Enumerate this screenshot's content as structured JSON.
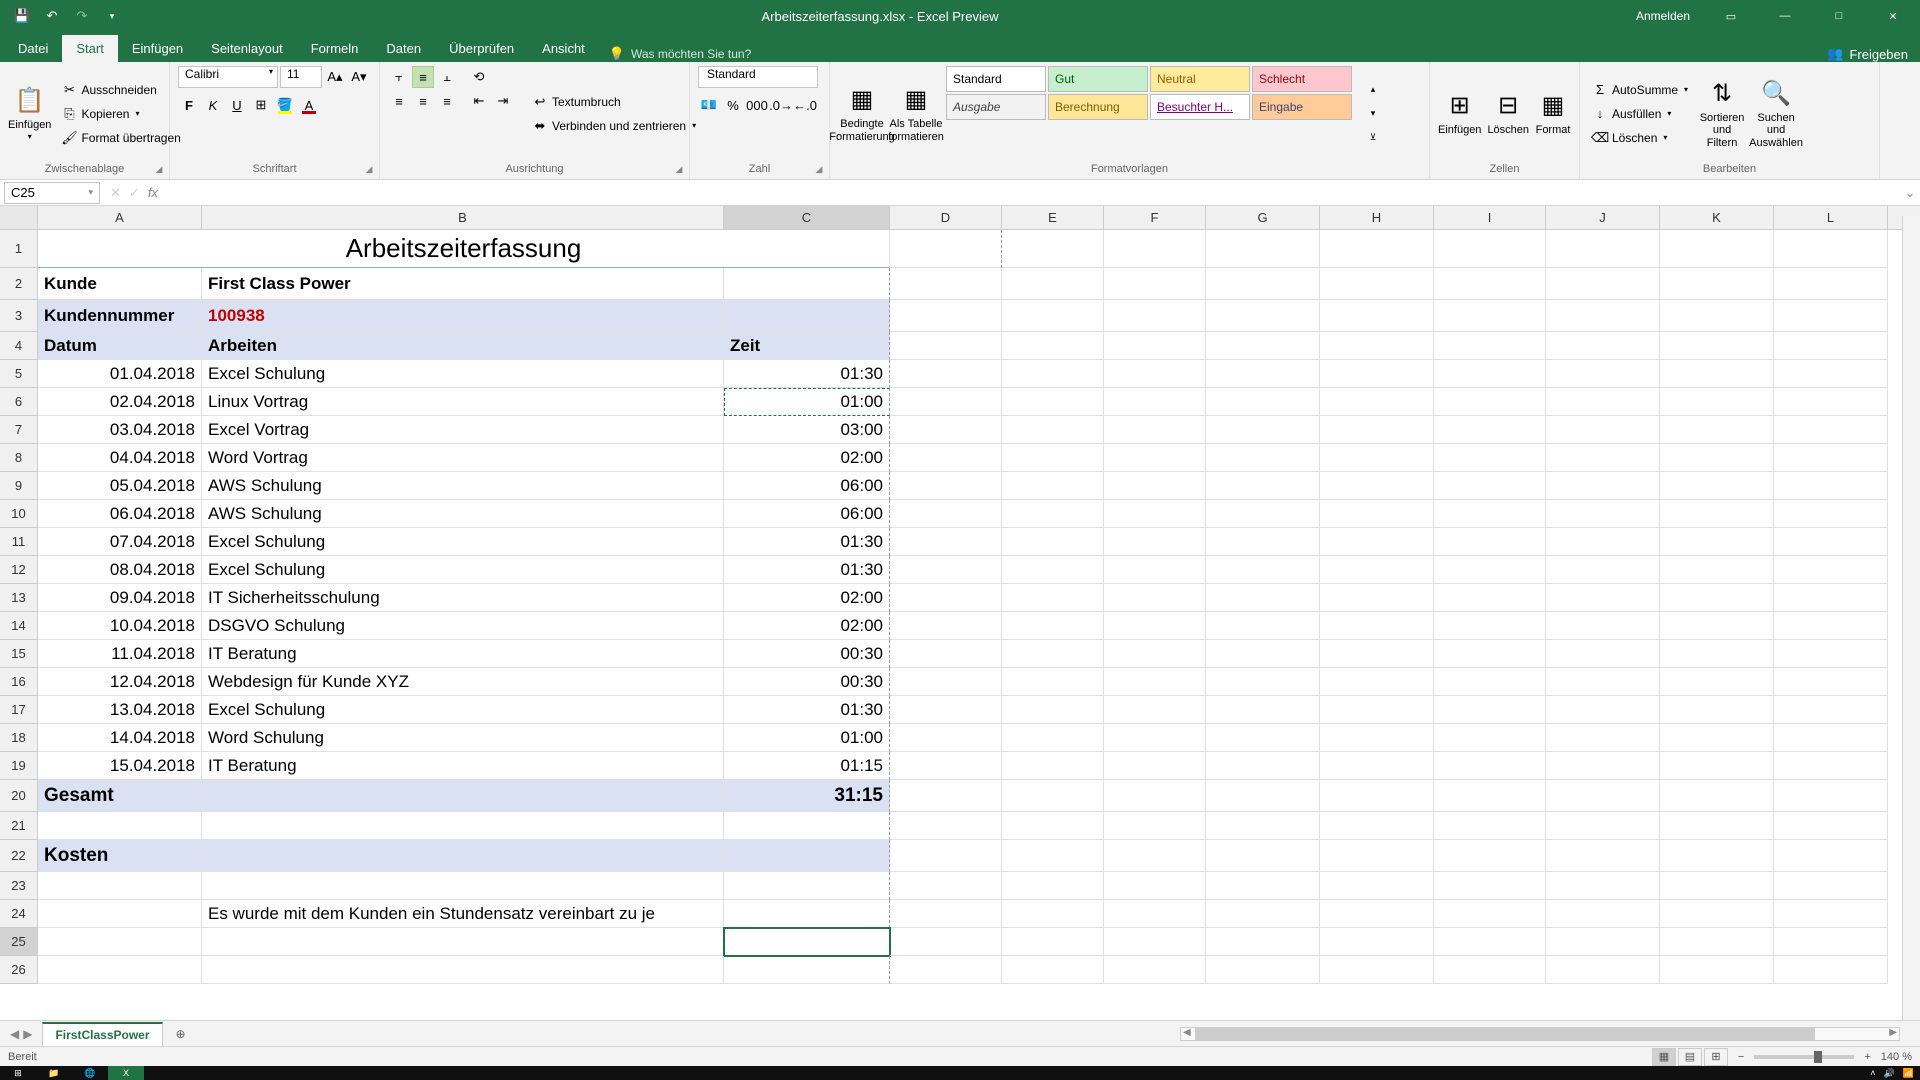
{
  "titlebar": {
    "title": "Arbeitszeiterfassung.xlsx - Excel Preview",
    "signin": "Anmelden"
  },
  "tabs": {
    "datei": "Datei",
    "start": "Start",
    "einfuegen": "Einfügen",
    "seitenlayout": "Seitenlayout",
    "formeln": "Formeln",
    "daten": "Daten",
    "ueberpruefen": "Überprüfen",
    "ansicht": "Ansicht",
    "tellme": "Was möchten Sie tun?",
    "freigeben": "Freigeben"
  },
  "ribbon": {
    "clipboard": {
      "einfuegen": "Einfügen",
      "ausschneiden": "Ausschneiden",
      "kopieren": "Kopieren",
      "format": "Format übertragen",
      "label": "Zwischenablage"
    },
    "schrift": {
      "font": "Calibri",
      "size": "11",
      "label": "Schriftart"
    },
    "ausrichtung": {
      "umbruch": "Textumbruch",
      "verbinden": "Verbinden und zentrieren",
      "label": "Ausrichtung"
    },
    "zahl": {
      "format": "Standard",
      "label": "Zahl"
    },
    "formatvorlagen": {
      "bedingte": "Bedingte Formatierung",
      "tabelle": "Als Tabelle formatieren",
      "standard": "Standard",
      "gut": "Gut",
      "neutral": "Neutral",
      "schlecht": "Schlecht",
      "ausgabe": "Ausgabe",
      "berechnung": "Berechnung",
      "besucht": "Besuchter H...",
      "eingabe": "Eingabe",
      "label": "Formatvorlagen"
    },
    "zellen": {
      "einfuegen": "Einfügen",
      "loeschen": "Löschen",
      "format": "Format",
      "label": "Zellen"
    },
    "bearbeiten": {
      "autosumme": "AutoSumme",
      "ausfuellen": "Ausfüllen",
      "loeschen": "Löschen",
      "sortieren": "Sortieren und Filtern",
      "suchen": "Suchen und Auswählen",
      "label": "Bearbeiten"
    }
  },
  "formulabar": {
    "namebox": "C25"
  },
  "columns": [
    "A",
    "B",
    "C",
    "D",
    "E",
    "F",
    "G",
    "H",
    "I",
    "J",
    "K",
    "L"
  ],
  "sheet": {
    "title": "Arbeitszeiterfassung",
    "kunde_label": "Kunde",
    "kunde": "First Class Power",
    "kundennr_label": "Kundennummer",
    "kundennr": "100938",
    "h_datum": "Datum",
    "h_arbeiten": "Arbeiten",
    "h_zeit": "Zeit",
    "rows": [
      {
        "n": "5",
        "d": "01.04.2018",
        "a": "Excel Schulung",
        "z": "01:30"
      },
      {
        "n": "6",
        "d": "02.04.2018",
        "a": "Linux Vortrag",
        "z": "01:00"
      },
      {
        "n": "7",
        "d": "03.04.2018",
        "a": "Excel Vortrag",
        "z": "03:00"
      },
      {
        "n": "8",
        "d": "04.04.2018",
        "a": "Word Vortrag",
        "z": "02:00"
      },
      {
        "n": "9",
        "d": "05.04.2018",
        "a": "AWS Schulung",
        "z": "06:00"
      },
      {
        "n": "10",
        "d": "06.04.2018",
        "a": "AWS Schulung",
        "z": "06:00"
      },
      {
        "n": "11",
        "d": "07.04.2018",
        "a": "Excel Schulung",
        "z": "01:30"
      },
      {
        "n": "12",
        "d": "08.04.2018",
        "a": "Excel Schulung",
        "z": "01:30"
      },
      {
        "n": "13",
        "d": "09.04.2018",
        "a": "IT Sicherheitsschulung",
        "z": "02:00"
      },
      {
        "n": "14",
        "d": "10.04.2018",
        "a": "DSGVO Schulung",
        "z": "02:00"
      },
      {
        "n": "15",
        "d": "11.04.2018",
        "a": "IT Beratung",
        "z": "00:30"
      },
      {
        "n": "16",
        "d": "12.04.2018",
        "a": "Webdesign für Kunde XYZ",
        "z": "00:30"
      },
      {
        "n": "17",
        "d": "13.04.2018",
        "a": "Excel Schulung",
        "z": "01:30"
      },
      {
        "n": "18",
        "d": "14.04.2018",
        "a": "Word Schulung",
        "z": "01:00"
      },
      {
        "n": "19",
        "d": "15.04.2018",
        "a": "IT Beratung",
        "z": "01:15"
      }
    ],
    "gesamt_label": "Gesamt",
    "gesamt": "31:15",
    "kosten": "Kosten",
    "note": "Es wurde mit dem Kunden ein Stundensatz vereinbart zu je"
  },
  "sheettab": {
    "name": "FirstClassPower"
  },
  "status": {
    "bereit": "Bereit",
    "zoom": "140 %"
  }
}
